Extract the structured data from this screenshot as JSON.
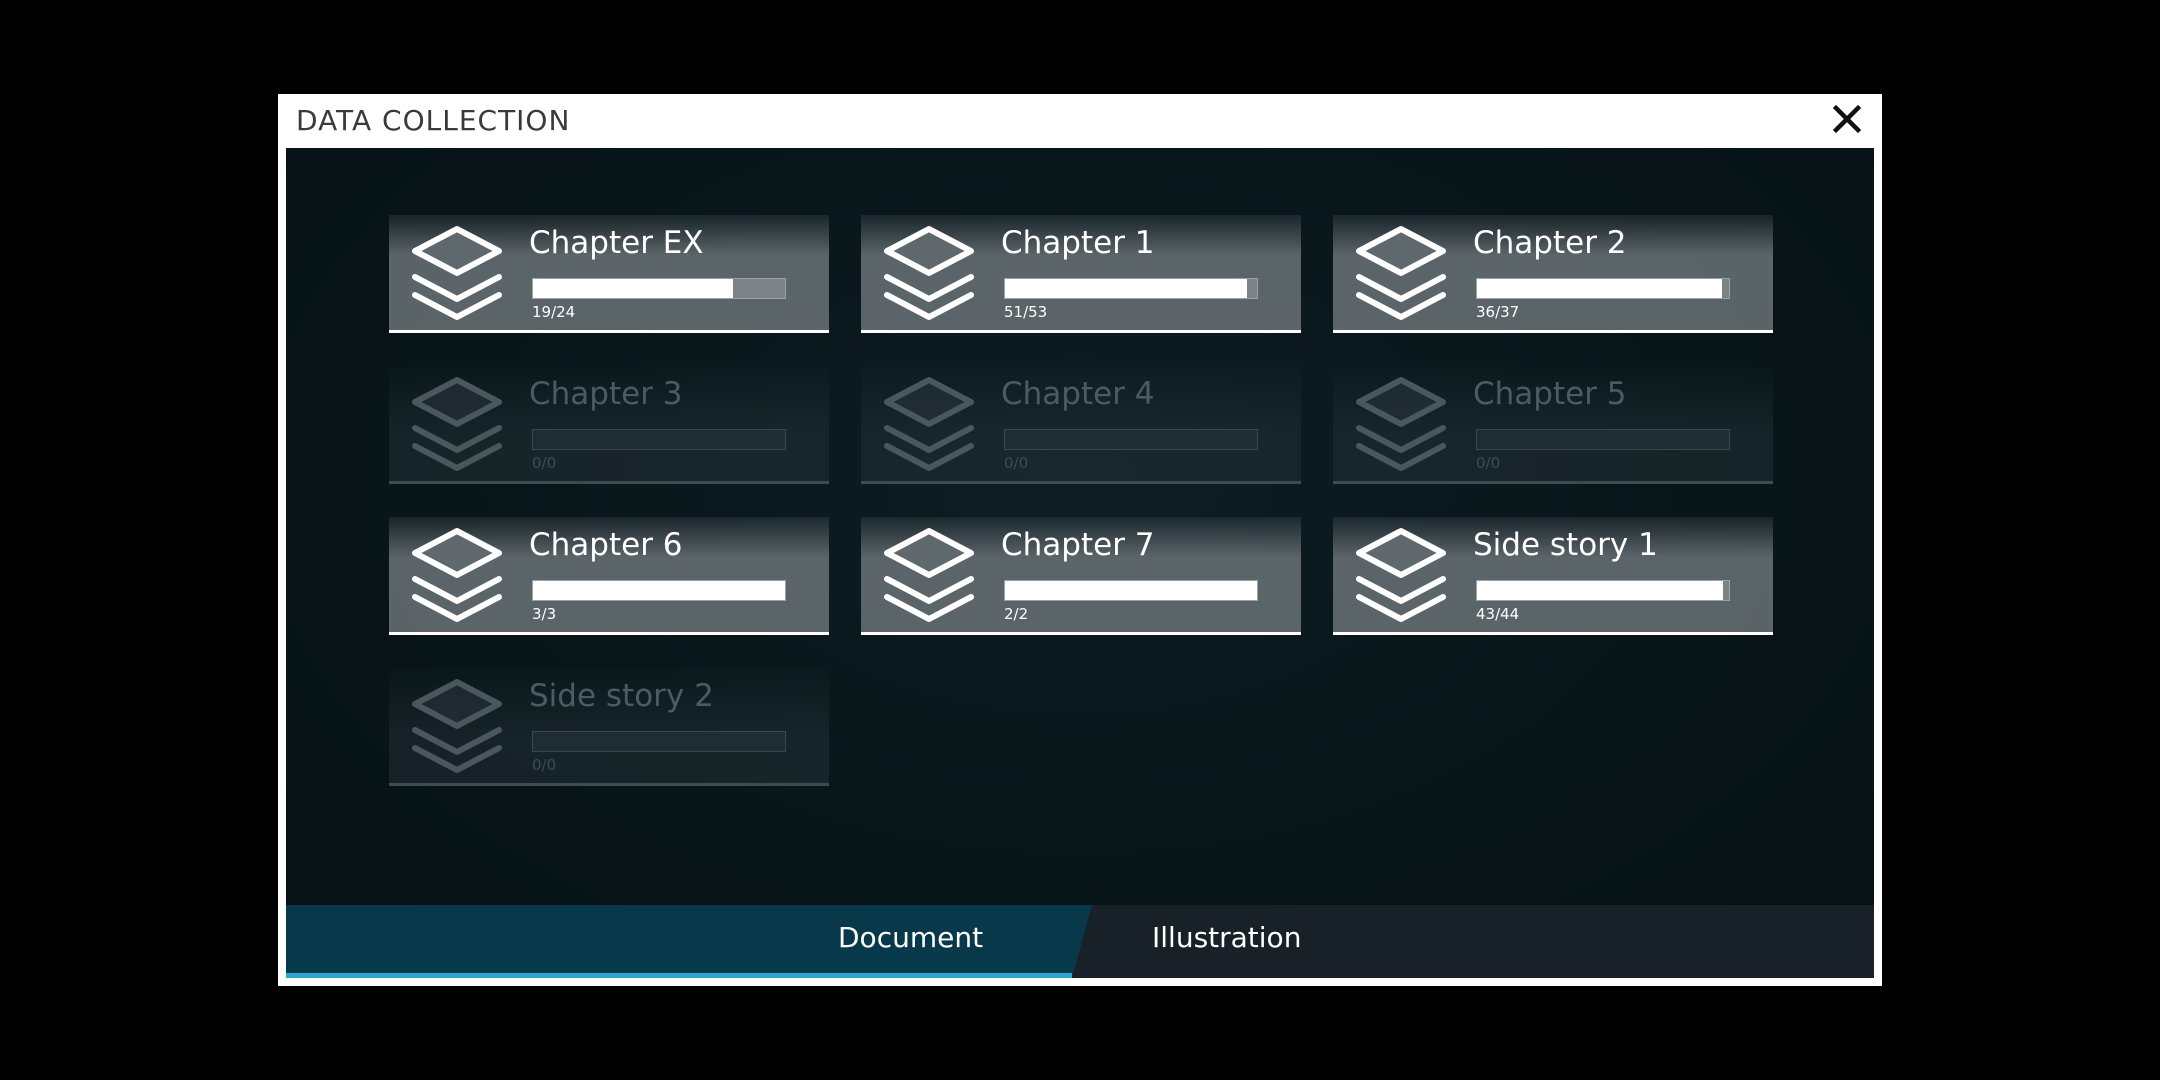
{
  "dialog": {
    "title": "DATA COLLECTION",
    "close_icon": "close-icon"
  },
  "colors": {
    "accent": "#29a8d6",
    "active_tab": "#07394a",
    "card_unlocked": "#5f686d",
    "card_locked": "#28343a"
  },
  "chapters": [
    {
      "name": "Chapter EX",
      "count": "19/24",
      "collected": 19,
      "total": 24,
      "locked": false,
      "icon": "layers-icon"
    },
    {
      "name": "Chapter 1",
      "count": "51/53",
      "collected": 51,
      "total": 53,
      "locked": false,
      "icon": "layers-icon"
    },
    {
      "name": "Chapter 2",
      "count": "36/37",
      "collected": 36,
      "total": 37,
      "locked": false,
      "icon": "layers-icon"
    },
    {
      "name": "Chapter 3",
      "count": "0/0",
      "collected": 0,
      "total": 0,
      "locked": true,
      "icon": "layers-icon"
    },
    {
      "name": "Chapter 4",
      "count": "0/0",
      "collected": 0,
      "total": 0,
      "locked": true,
      "icon": "layers-icon"
    },
    {
      "name": "Chapter 5",
      "count": "0/0",
      "collected": 0,
      "total": 0,
      "locked": true,
      "icon": "layers-icon"
    },
    {
      "name": "Chapter 6",
      "count": "3/3",
      "collected": 3,
      "total": 3,
      "locked": false,
      "icon": "layers-icon"
    },
    {
      "name": "Chapter 7",
      "count": "2/2",
      "collected": 2,
      "total": 2,
      "locked": false,
      "icon": "layers-icon"
    },
    {
      "name": "Side story 1",
      "count": "43/44",
      "collected": 43,
      "total": 44,
      "locked": false,
      "icon": "layers-icon"
    },
    {
      "name": "Side story 2",
      "count": "0/0",
      "collected": 0,
      "total": 0,
      "locked": true,
      "icon": "layers-icon"
    }
  ],
  "tabs": [
    {
      "label": "Document",
      "active": true
    },
    {
      "label": "Illustration",
      "active": false
    }
  ]
}
